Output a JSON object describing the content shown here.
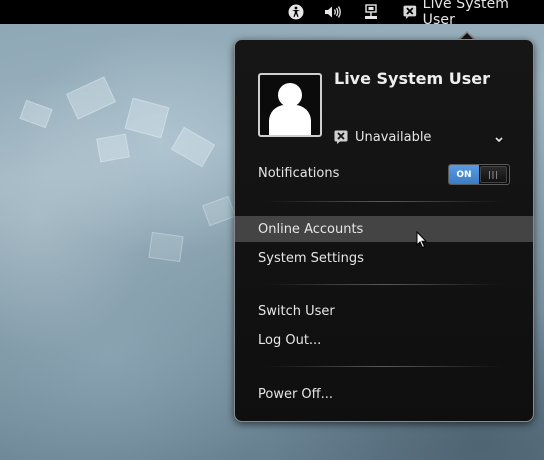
{
  "topbar": {
    "accessibility_icon": "accessibility-icon",
    "volume_icon": "volume-icon",
    "network_icon": "network-wired-icon",
    "user_status_icon": "user-unavailable-icon",
    "user_name": "Live System User"
  },
  "menu": {
    "avatar_icon": "user-avatar-icon",
    "user_name": "Live System User",
    "status": {
      "icon": "user-unavailable-icon",
      "label": "Unavailable",
      "chevron": "chevron-down-icon"
    },
    "notifications": {
      "label": "Notifications",
      "toggle_on_label": "ON",
      "enabled": true
    },
    "items": [
      {
        "label": "Online Accounts",
        "hovered": true
      },
      {
        "label": "System Settings"
      },
      {
        "label": "Switch User"
      },
      {
        "label": "Log Out..."
      },
      {
        "label": "Power Off..."
      }
    ]
  },
  "colors": {
    "toggle_on": "#3a7cc8",
    "menu_background": "#121212",
    "hover_background": "#444444"
  }
}
